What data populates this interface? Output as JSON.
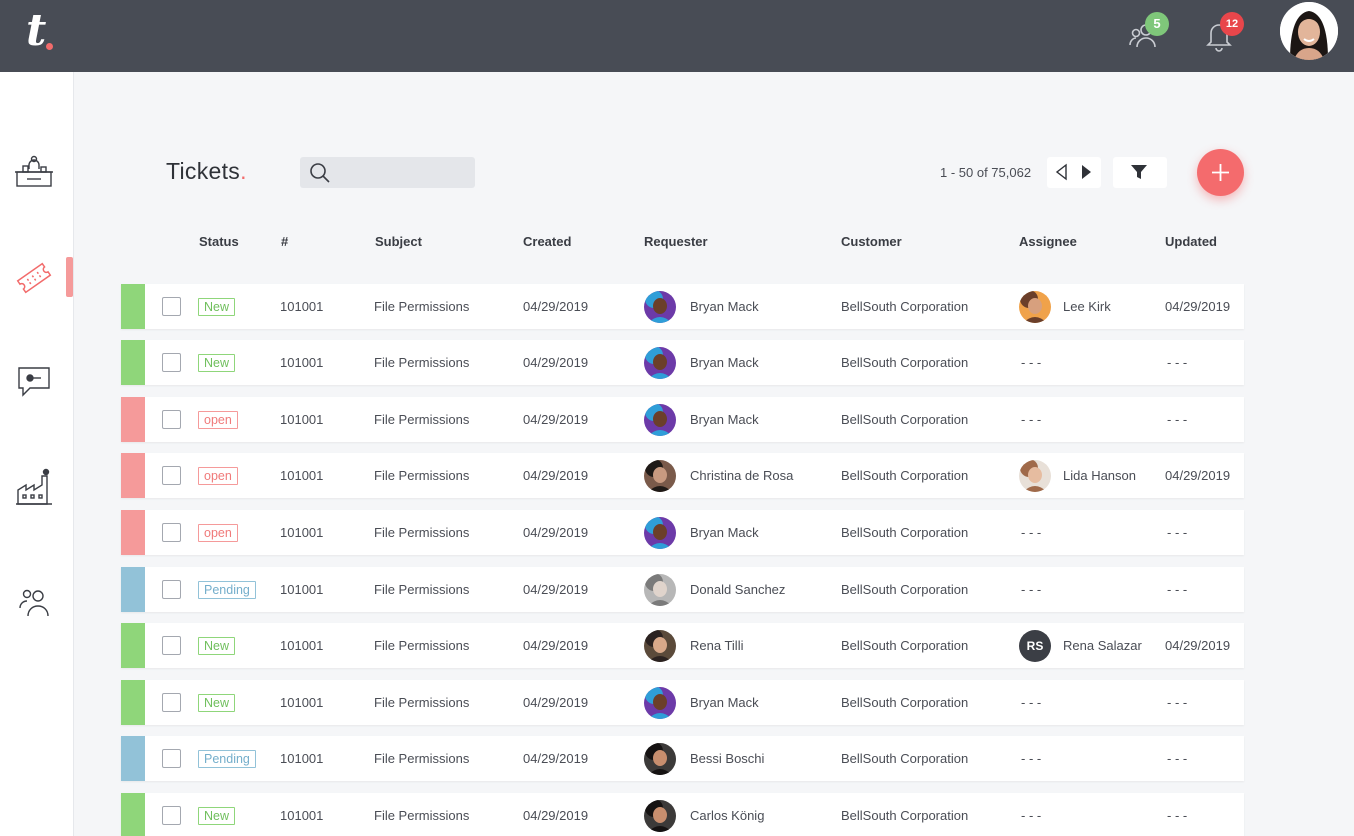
{
  "app": {
    "logo_letter": "t"
  },
  "header": {
    "contacts_badge": "5",
    "notifications_badge": "12"
  },
  "page": {
    "title": "Tickets",
    "title_dot": ".",
    "search_placeholder": "",
    "pagination": "1 - 50 of 75,062"
  },
  "columns": {
    "status": "Status",
    "number": "#",
    "subject": "Subject",
    "created": "Created",
    "requester": "Requester",
    "customer": "Customer",
    "assignee": "Assignee",
    "updated": "Updated"
  },
  "colors": {
    "new": "#8fd67a",
    "open": "#f59a9a",
    "pending": "#92c2d8",
    "accent": "#f46b6d"
  },
  "rows": [
    {
      "status": "New",
      "number": "101001",
      "subject": "File Permissions",
      "created": "04/29/2019",
      "requester": "Bryan Mack",
      "customer": "BellSouth Corporation",
      "assignee": "Lee Kirk",
      "updated": "04/29/2019"
    },
    {
      "status": "New",
      "number": "101001",
      "subject": "File Permissions",
      "created": "04/29/2019",
      "requester": "Bryan Mack",
      "customer": "BellSouth Corporation",
      "assignee": "- - -",
      "updated": "- - -"
    },
    {
      "status": "open",
      "number": "101001",
      "subject": "File Permissions",
      "created": "04/29/2019",
      "requester": "Bryan Mack",
      "customer": "BellSouth Corporation",
      "assignee": "- - -",
      "updated": "- - -"
    },
    {
      "status": "open",
      "number": "101001",
      "subject": "File Permissions",
      "created": "04/29/2019",
      "requester": "Christina de Rosa",
      "customer": "BellSouth Corporation",
      "assignee": "Lida Hanson",
      "updated": "04/29/2019"
    },
    {
      "status": "open",
      "number": "101001",
      "subject": "File Permissions",
      "created": "04/29/2019",
      "requester": "Bryan Mack",
      "customer": "BellSouth Corporation",
      "assignee": "- - -",
      "updated": "- - -"
    },
    {
      "status": "Pending",
      "number": "101001",
      "subject": "File Permissions",
      "created": "04/29/2019",
      "requester": "Donald Sanchez",
      "customer": "BellSouth Corporation",
      "assignee": "- - -",
      "updated": "- - -"
    },
    {
      "status": "New",
      "number": "101001",
      "subject": "File Permissions",
      "created": "04/29/2019",
      "requester": "Rena Tilli",
      "customer": "BellSouth Corporation",
      "assignee": "Rena Salazar",
      "assignee_initials": "RS",
      "updated": "04/29/2019"
    },
    {
      "status": "New",
      "number": "101001",
      "subject": "File Permissions",
      "created": "04/29/2019",
      "requester": "Bryan Mack",
      "customer": "BellSouth Corporation",
      "assignee": "- - -",
      "updated": "- - -"
    },
    {
      "status": "Pending",
      "number": "101001",
      "subject": "File Permissions",
      "created": "04/29/2019",
      "requester": "Bessi Boschi",
      "customer": "BellSouth Corporation",
      "assignee": "- - -",
      "updated": "- - -"
    },
    {
      "status": "New",
      "number": "101001",
      "subject": "File Permissions",
      "created": "04/29/2019",
      "requester": "Carlos König",
      "customer": "BellSouth Corporation",
      "assignee": "- - -",
      "updated": "- - -"
    }
  ]
}
